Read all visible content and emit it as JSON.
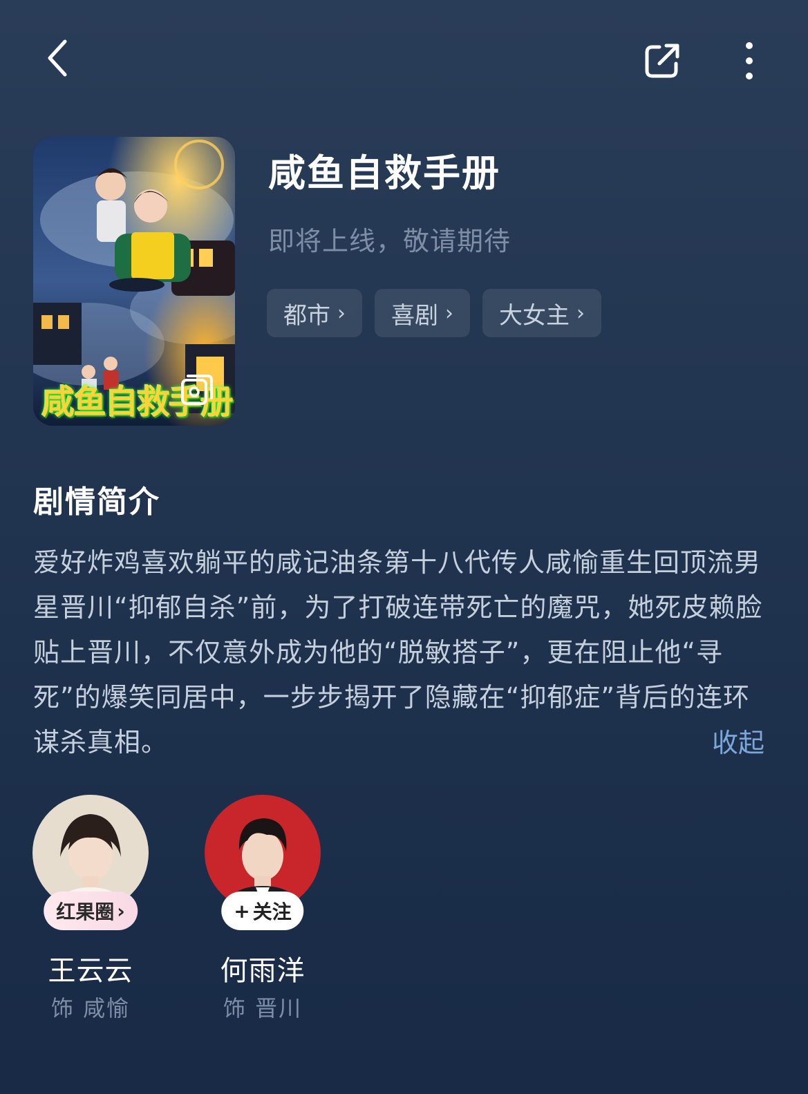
{
  "header": {
    "back_icon": "chevron-left-icon",
    "share_icon": "share-external-icon",
    "more_icon": "more-vertical-icon"
  },
  "drama": {
    "title": "咸鱼自救手册",
    "status": "即将上线，敬请期待",
    "poster_text": "咸鱼自救手册",
    "tags": [
      {
        "label": "都市"
      },
      {
        "label": "喜剧"
      },
      {
        "label": "大女主"
      }
    ]
  },
  "synopsis": {
    "heading": "剧情简介",
    "text": "爱好炸鸡喜欢躺平的咸记油条第十八代传人咸愉重生回顶流男星晋川“抑郁自杀”前，为了打破连带死亡的魔咒，她死皮赖脸贴上晋川，不仅意外成为他的“脱敏搭子”，更在阻止他“寻死”的爆笑同居中，一步步揭开了隐藏在“抑郁症”背后的连环谋杀真相。",
    "collapse_label": "收起"
  },
  "cast": [
    {
      "name": "王云云",
      "role": "饰 咸愉",
      "badge": "红果圈",
      "badge_suffix": "›"
    },
    {
      "name": "何雨洋",
      "role": "饰 晋川",
      "badge": "关注",
      "badge_prefix": "+"
    }
  ],
  "colors": {
    "background_top": "#2a3d58",
    "background_bottom": "#182a45",
    "accent_link": "#7da7d8",
    "muted_text": "#7d8ea6"
  }
}
